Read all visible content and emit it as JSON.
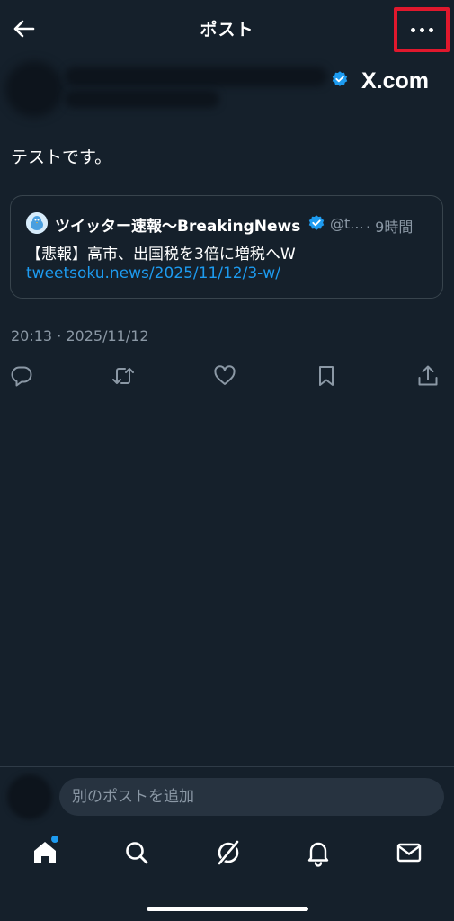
{
  "header": {
    "title": "ポスト"
  },
  "author": {
    "badge": "X.com"
  },
  "post": {
    "text": "テストです。",
    "timestamp": "20:13 · 2025/11/12"
  },
  "quote": {
    "name": "ツイッター速報〜BreakingNews",
    "handle": "@t...",
    "time": "· 9時間",
    "text": "【悲報】高市、出国税を3倍に増税へW",
    "link": "tweetsoku.news/2025/11/12/3-w/"
  },
  "reply": {
    "placeholder": "別のポストを追加"
  },
  "colors": {
    "background": "#15202b",
    "accent": "#1d9bf0",
    "highlight_box": "#e0182d",
    "muted_text": "#8b98a5"
  },
  "icons": {
    "actions": [
      "reply-icon",
      "repost-icon",
      "like-icon",
      "bookmark-icon",
      "share-icon"
    ],
    "tabs": [
      "home-icon",
      "search-icon",
      "grok-icon",
      "notifications-icon",
      "messages-icon"
    ]
  }
}
